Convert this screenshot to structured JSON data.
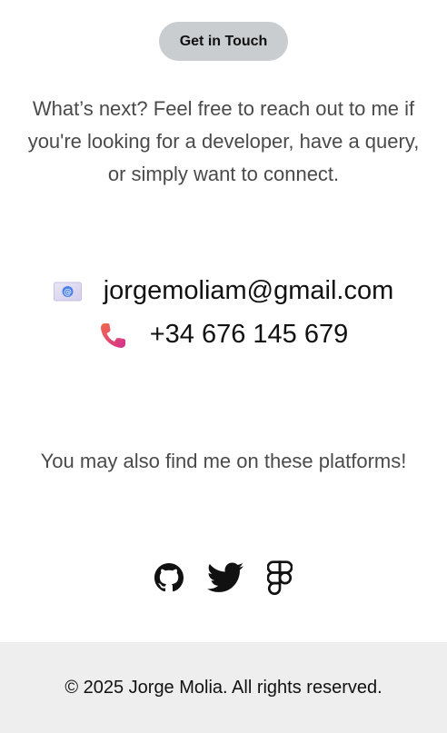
{
  "header": {
    "badge_label": "Get in Touch"
  },
  "intro": {
    "text": "What’s next? Feel free to reach out to me if you're looking for a developer, have a query, or simply want to connect."
  },
  "contact": {
    "email": "jorgemoliam@gmail.com",
    "email_icon": "email-icon",
    "phone": "+34 676 145 679",
    "phone_icon": "phone-icon"
  },
  "platforms": {
    "text": "You may also find me on these platforms!",
    "icons": [
      "github-icon",
      "twitter-icon",
      "figma-icon"
    ]
  },
  "footer": {
    "text": "© 2025 Jorge Molia. All rights reserved."
  },
  "colors": {
    "badge_bg": "#c9cdd0",
    "footer_bg": "#eeeeee",
    "phone_icon": "#e0407a",
    "email_icon": "#4a80e8"
  }
}
